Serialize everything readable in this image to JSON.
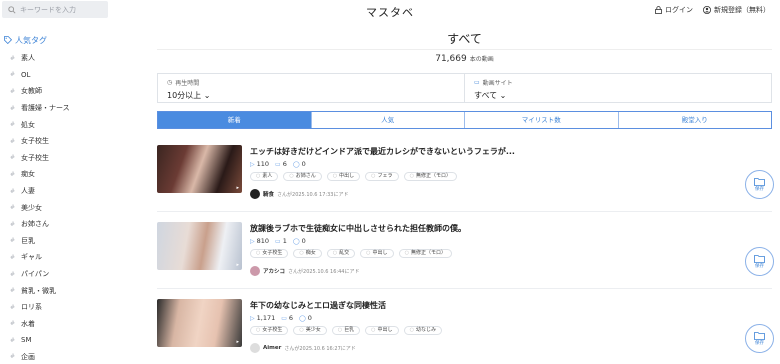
{
  "header": {
    "search_placeholder": "キーワードを入力",
    "logo": "マスタベ",
    "login": "ログイン",
    "register": "新規登録（無料）"
  },
  "sidebar": {
    "title": "人気タグ",
    "tags": [
      "素人",
      "OL",
      "女教師",
      "看護婦・ナース",
      "処女",
      "女子校生",
      "女子校生",
      "痴女",
      "人妻",
      "美少女",
      "お姉さん",
      "巨乳",
      "ギャル",
      "パイパン",
      "貧乳・微乳",
      "ロリ系",
      "水着",
      "SM",
      "企画"
    ]
  },
  "main": {
    "title": "すべて",
    "count": "71,669",
    "count_unit": "本の動画",
    "filters": [
      {
        "label": "再生時間",
        "value": "10分以上"
      },
      {
        "label": "動画サイト",
        "value": "すべて"
      }
    ],
    "tabs": [
      "新着",
      "人気",
      "マイリスト数",
      "殿堂入り"
    ]
  },
  "videos": [
    {
      "title": "エッチは好きだけどインドア派で最近カレシができないというフェラが...",
      "views": "110",
      "lists": "6",
      "comments": "0",
      "tags": [
        "素人",
        "お姉さん",
        "中出し",
        "フェラ",
        "無修正（モロ）"
      ],
      "user": "騎食",
      "date": "さんが2025.10.6 17:33にアド",
      "save": "保存"
    },
    {
      "title": "放課後ラブホで生徒痴女に中出しさせられた担任教師の僕。",
      "views": "810",
      "lists": "1",
      "comments": "0",
      "tags": [
        "女子校生",
        "痴女",
        "乱交",
        "中出し",
        "無修正（モロ）"
      ],
      "user": "アカシコ",
      "date": "さんが2025.10.6 16:44にアド",
      "save": "保存"
    },
    {
      "title": "年下の幼なじみとエロ過ぎな同棲性活",
      "views": "1,171",
      "lists": "6",
      "comments": "0",
      "tags": [
        "女子校生",
        "美少女",
        "巨乳",
        "中出し",
        "幼なじみ"
      ],
      "user": "Aimer",
      "date": "さんが2025.10.6 16:27にアド",
      "save": "保存"
    }
  ],
  "colors": {
    "accent": "#4a8be0",
    "tag_title": "#3b82d6"
  }
}
